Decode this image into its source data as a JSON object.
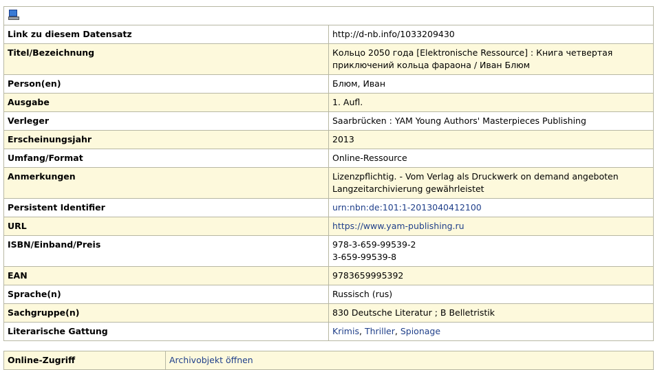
{
  "toolbar": {
    "icon": "computer-icon"
  },
  "rows": [
    {
      "label": "Link zu diesem Datensatz",
      "lines": [
        "http://d-nb.info/1033209430"
      ],
      "link": false
    },
    {
      "label": "Titel/Bezeichnung",
      "lines": [
        "Кольцо 2050 года [Elektronische Ressource] : Книга четвертая приключений кольца фараона / Иван Блюм"
      ],
      "link": false
    },
    {
      "label": "Person(en)",
      "lines": [
        "Блюм, Иван"
      ],
      "link": false
    },
    {
      "label": "Ausgabe",
      "lines": [
        "1. Aufl."
      ],
      "link": false
    },
    {
      "label": "Verleger",
      "lines": [
        "Saarbrücken : YAM Young Authors' Masterpieces Publishing"
      ],
      "link": false
    },
    {
      "label": "Erscheinungsjahr",
      "lines": [
        "2013"
      ],
      "link": false
    },
    {
      "label": "Umfang/Format",
      "lines": [
        "Online-Ressource"
      ],
      "link": false
    },
    {
      "label": "Anmerkungen",
      "lines": [
        "Lizenzpflichtig. - Vom Verlag als Druckwerk on demand angeboten",
        "Langzeitarchivierung gewährleistet"
      ],
      "link": false
    },
    {
      "label": "Persistent Identifier",
      "lines": [
        "urn:nbn:de:101:1-2013040412100"
      ],
      "link": true
    },
    {
      "label": "URL",
      "lines": [
        "https://www.yam-publishing.ru"
      ],
      "link": true
    },
    {
      "label": "ISBN/Einband/Preis",
      "lines": [
        "978-3-659-99539-2",
        "3-659-99539-8"
      ],
      "link": false
    },
    {
      "label": "EAN",
      "lines": [
        "9783659995392"
      ],
      "link": false
    },
    {
      "label": "Sprache(n)",
      "lines": [
        "Russisch (rus)"
      ],
      "link": false
    },
    {
      "label": "Sachgruppe(n)",
      "lines": [
        "830 Deutsche Literatur ; B Belletristik"
      ],
      "link": false
    },
    {
      "label": "Literarische Gattung",
      "links": [
        "Krimis",
        "Thriller",
        "Spionage"
      ],
      "separator": ", "
    }
  ],
  "online": {
    "label": "Online-Zugriff",
    "link_text": "Archivobjekt öffnen"
  },
  "colors": {
    "row_alt": "#fdf9dc",
    "border": "#b7b7a3",
    "link": "#1f3f8a"
  }
}
